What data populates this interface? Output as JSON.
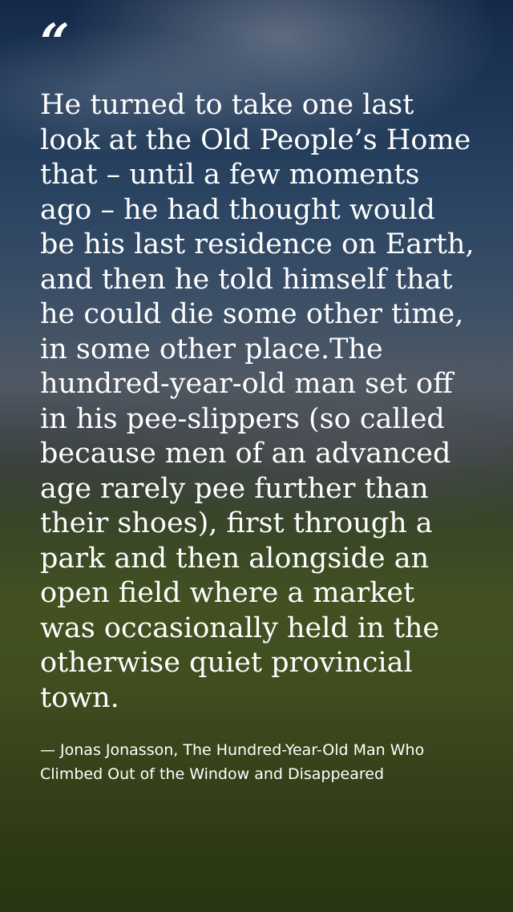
{
  "quote": {
    "mark": "“",
    "text": "He turned to take one last look at the Old People’s Home that – until a few moments ago – he had thought would be his last residence on Earth, and then he told himself that he could die some other time, in some other place.The hundred-year-old man set off in his pee-slippers (so called because men of an advanced age rarely pee further than their shoes), first through a park and then alongside an open field where a market was occasionally held in the otherwise quiet provincial town.",
    "attribution": "— Jonas Jonasson, The Hundred-Year-Old Man Who Climbed Out of the Window and Disappeared"
  },
  "background": {
    "description_icon": "landscape-photo"
  }
}
